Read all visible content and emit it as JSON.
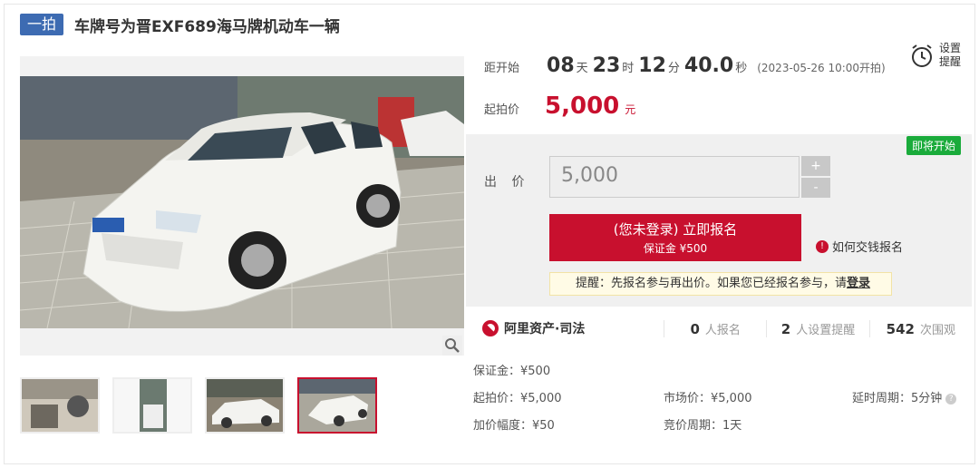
{
  "header": {
    "badge": "一拍",
    "title": "车牌号为晋EXF689海马牌机动车一辆"
  },
  "countdown": {
    "label": "距开始",
    "days": "08",
    "days_unit": "天",
    "hours": "23",
    "hours_unit": "时",
    "minutes": "12",
    "minutes_unit": "分",
    "seconds": "40.0",
    "seconds_unit": "秒",
    "start_time": "(2023-05-26 10:00开拍)"
  },
  "alarm": {
    "icon": "alarm-clock-icon",
    "text": "设置提醒"
  },
  "start_price": {
    "label": "起拍价",
    "amount": "5,000",
    "unit": "元"
  },
  "bid": {
    "status_badge": "即将开始",
    "label": "出 价",
    "value": "5,000",
    "plus": "+",
    "minus": "-",
    "apply_line1": "(您未登录) 立即报名",
    "apply_line2": "保证金 ¥500",
    "how_to": "如何交钱报名",
    "reminder": "提醒：先报名参与再出价。如果您已经报名参与，请",
    "reminder_link": "登录"
  },
  "stats": {
    "brand": "阿里资产·司法",
    "signup_count": "0",
    "signup_label": "人报名",
    "remind_count": "2",
    "remind_label": "人设置提醒",
    "views_count": "542",
    "views_label": "次围观"
  },
  "details": {
    "deposit": "保证金：¥500",
    "start_price": "起拍价：¥5,000",
    "market_price": "市场价：¥5,000",
    "delay": "延时周期：5分钟",
    "increment": "加价幅度：¥50",
    "period": "竞价周期：1天"
  },
  "colors": {
    "accent": "#c8102e",
    "badge": "#3d6bb2",
    "soon": "#1aab3b"
  }
}
